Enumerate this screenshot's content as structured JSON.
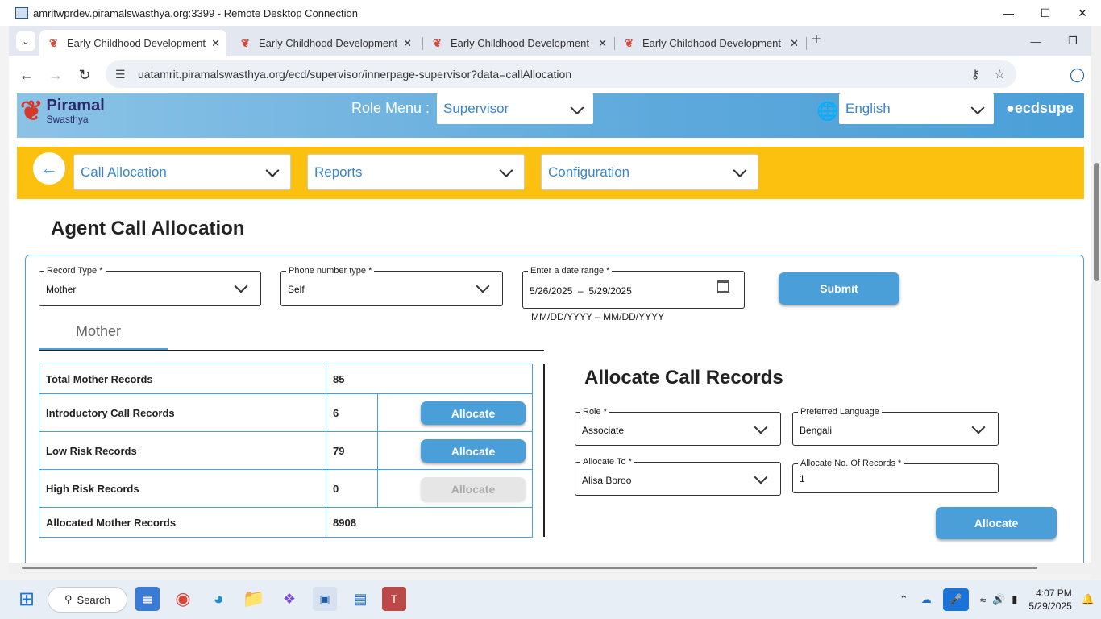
{
  "remote_desktop": {
    "title": "amritwprdev.piramalswasthya.org:3399 - Remote Desktop Connection"
  },
  "browser": {
    "tabs": [
      {
        "label": "Early Childhood Development",
        "active": true
      },
      {
        "label": "Early Childhood Development",
        "active": false
      },
      {
        "label": "Early Childhood Development",
        "active": false
      },
      {
        "label": "Early Childhood Development",
        "active": false
      }
    ],
    "url": "uatamrit.piramalswasthya.org/ecd/supervisor/innerpage-supervisor?data=callAllocation"
  },
  "header": {
    "logo_name": "Piramal",
    "logo_sub": "Swasthya",
    "role_menu_label": "Role Menu :",
    "role_value": "Supervisor",
    "language_value": "English",
    "user_name": "ecdsupe"
  },
  "nav": {
    "call_allocation": "Call Allocation",
    "reports": "Reports",
    "configuration": "Configuration"
  },
  "main": {
    "title": "Agent Call Allocation",
    "filters": {
      "record_type_label": "Record Type",
      "record_type_value": "Mother",
      "phone_type_label": "Phone number type",
      "phone_type_value": "Self",
      "date_range_label": "Enter a date range",
      "date_range_value": "5/26/2025  –  5/29/2025",
      "date_hint": "MM/DD/YYYY – MM/DD/YYYY",
      "submit_label": "Submit"
    },
    "record_tab": "Mother",
    "stats": [
      {
        "label": "Total Mother Records",
        "value": "85",
        "has_button": false
      },
      {
        "label": "Introductory Call Records",
        "value": "6",
        "has_button": true,
        "button": "Allocate",
        "disabled": false
      },
      {
        "label": "Low Risk Records",
        "value": "79",
        "has_button": true,
        "button": "Allocate",
        "disabled": false
      },
      {
        "label": "High Risk Records",
        "value": "0",
        "has_button": true,
        "button": "Allocate",
        "disabled": true
      },
      {
        "label": "Allocated Mother Records",
        "value": "8908",
        "has_button": false
      }
    ],
    "allocate": {
      "title": "Allocate Call Records",
      "role_label": "Role",
      "role_value": "Associate",
      "language_label": "Preferred Language",
      "language_value": "Bengali",
      "allocate_to_label": "Allocate To",
      "allocate_to_value": "Alisa Boroo",
      "num_records_label": "Allocate No. Of Records",
      "num_records_value": "1",
      "allocate_button": "Allocate"
    }
  },
  "taskbar": {
    "search_label": "Search",
    "time": "4:07 PM",
    "date": "5/29/2025"
  },
  "colors": {
    "accent": "#4a9fd8",
    "yellow": "#fcc10f",
    "brand_red": "#d33a2c"
  }
}
